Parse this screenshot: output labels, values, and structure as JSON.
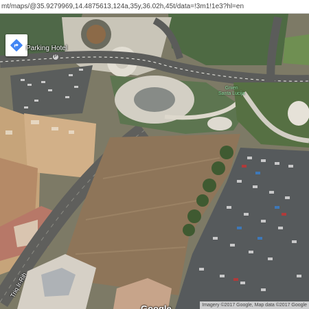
{
  "browser": {
    "url": "mt/maps/@35.9279969,14.4875613,124a,35y,36.02h,45t/data=!3m1!1e3?hl=en"
  },
  "map": {
    "place_label": "Parking Hotel",
    "pin_glyph": "P",
    "garden_label_line1": "Gnien",
    "garden_label_line2": "Santa Lucija",
    "street_label": "Triq Ir-Rih",
    "logo": "Google",
    "attribution": "Imagery ©2017 Google, Map data ©2017 Google",
    "directions_icon": "directions-diamond-icon",
    "colors": {
      "directions_blue": "#4285f4",
      "garden_label": "#8ee0a2"
    }
  }
}
